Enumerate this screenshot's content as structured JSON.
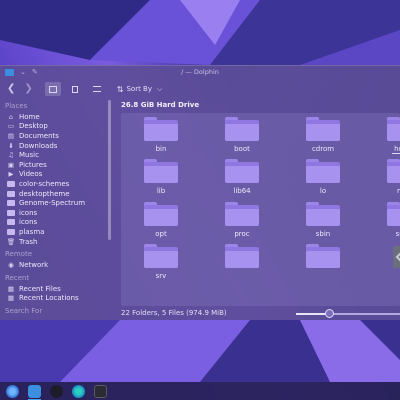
{
  "window": {
    "title": "/ — Dolphin",
    "back_glyph": "❮",
    "forward_glyph": "❯",
    "icons": [
      "dolphin-app-icon",
      "minimize-icon",
      "pin-icon",
      "back-icon",
      "forward-icon",
      "icon-view-icon",
      "compact-view-icon",
      "details-view-icon",
      "sort-icon",
      "chevron-down-icon"
    ]
  },
  "toolbar": {
    "sort_label": "Sort By",
    "sort_glyph": "⇅",
    "chevron_glyph": "⌵"
  },
  "places": {
    "places_header": "Places",
    "items": [
      {
        "label": "Home",
        "icon": "home-icon",
        "glyph": "⌂"
      },
      {
        "label": "Desktop",
        "icon": "desktop-icon",
        "glyph": "▭"
      },
      {
        "label": "Documents",
        "icon": "documents-icon",
        "glyph": "▤"
      },
      {
        "label": "Downloads",
        "icon": "downloads-icon",
        "glyph": "⬇"
      },
      {
        "label": "Music",
        "icon": "music-icon",
        "glyph": "♫"
      },
      {
        "label": "Pictures",
        "icon": "pictures-icon",
        "glyph": "▣"
      },
      {
        "label": "Videos",
        "icon": "videos-icon",
        "glyph": "▶"
      },
      {
        "label": "color-schemes",
        "icon": "folder-icon",
        "glyph": ""
      },
      {
        "label": "desktoptheme",
        "icon": "folder-icon",
        "glyph": ""
      },
      {
        "label": "Genome-Spectrum",
        "icon": "folder-icon",
        "glyph": ""
      },
      {
        "label": "icons",
        "icon": "folder-icon",
        "glyph": ""
      },
      {
        "label": "icons",
        "icon": "folder-icon",
        "glyph": ""
      },
      {
        "label": "plasma",
        "icon": "folder-icon",
        "glyph": ""
      },
      {
        "label": "Trash",
        "icon": "trash-icon",
        "glyph": "🗑"
      }
    ],
    "remote_header": "Remote",
    "network": {
      "label": "Network",
      "icon": "network-icon",
      "glyph": "◉"
    },
    "recent_header": "Recent",
    "recent_items": [
      {
        "label": "Recent Files",
        "icon": "recent-files-icon",
        "glyph": "▦"
      },
      {
        "label": "Recent Locations",
        "icon": "recent-locations-icon",
        "glyph": "▦"
      }
    ],
    "search_header": "Search For"
  },
  "main": {
    "drive_title": "26.8 GiB Hard Drive",
    "items": [
      {
        "label": "bin",
        "type": "folder"
      },
      {
        "label": "boot",
        "type": "folder"
      },
      {
        "label": "cdrom",
        "type": "folder"
      },
      {
        "label": "home",
        "type": "folder",
        "selected": true
      },
      {
        "label": "lib",
        "type": "folder"
      },
      {
        "label": "lib64",
        "type": "folder"
      },
      {
        "label": "lo",
        "type": "folder"
      },
      {
        "label": "mnt",
        "type": "folder"
      },
      {
        "label": "opt",
        "type": "folder"
      },
      {
        "label": "proc",
        "type": "folder"
      },
      {
        "label": "sbin",
        "type": "folder"
      },
      {
        "label": "snap",
        "type": "folder"
      },
      {
        "label": "srv",
        "type": "folder"
      },
      {
        "label": "",
        "type": "folder"
      },
      {
        "label": "",
        "type": "folder"
      },
      {
        "label": "",
        "type": "file"
      }
    ]
  },
  "status": {
    "text": "22 Folders, 5 Files (974.9 MiB)",
    "zoom_level": 0.33
  },
  "taskbar": {
    "icons": [
      "app-launcher-icon",
      "dolphin-task-icon",
      "steam-task-icon",
      "browser-task-icon",
      "terminal-task-icon"
    ]
  },
  "colors": {
    "accent": "#4b9ef0",
    "folder": "#a892f0",
    "window": "#5c4e98"
  }
}
